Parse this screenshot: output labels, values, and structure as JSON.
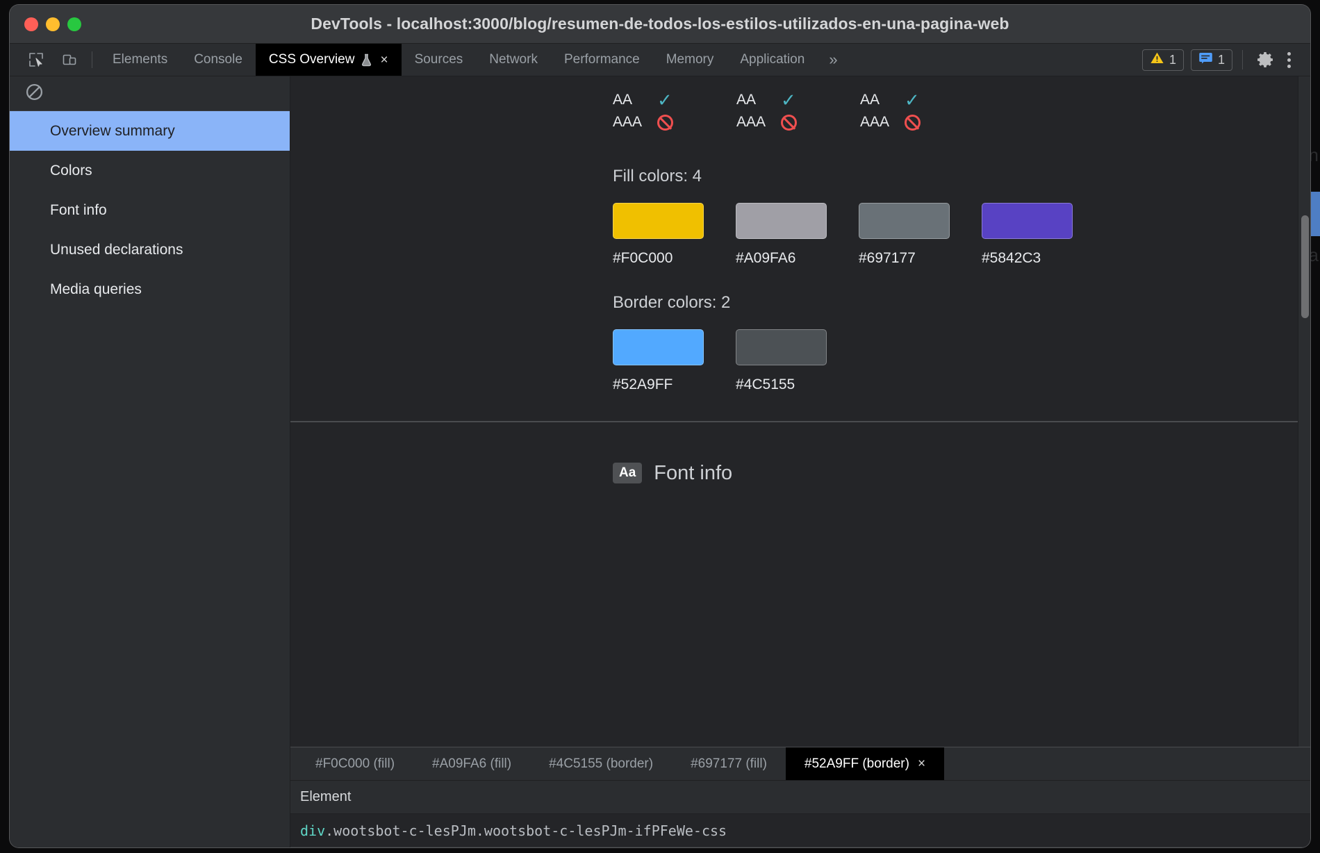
{
  "window": {
    "title": "DevTools - localhost:3000/blog/resumen-de-todos-los-estilos-utilizados-en-una-pagina-web",
    "traffic_lights": [
      "close",
      "minimize",
      "maximize"
    ]
  },
  "tabbar": {
    "inspect_icon": "inspect-cursor-icon",
    "device_icon": "device-toolbar-icon",
    "tabs": [
      {
        "label": "Elements",
        "active": false,
        "experimental": false,
        "closable": false
      },
      {
        "label": "Console",
        "active": false,
        "experimental": false,
        "closable": false
      },
      {
        "label": "CSS Overview",
        "active": true,
        "experimental": true,
        "closable": true
      },
      {
        "label": "Sources",
        "active": false,
        "experimental": false,
        "closable": false
      },
      {
        "label": "Network",
        "active": false,
        "experimental": false,
        "closable": false
      },
      {
        "label": "Performance",
        "active": false,
        "experimental": false,
        "closable": false
      },
      {
        "label": "Memory",
        "active": false,
        "experimental": false,
        "closable": false
      },
      {
        "label": "Application",
        "active": false,
        "experimental": false,
        "closable": false
      }
    ],
    "overflow_label": "»",
    "close_glyph": "×",
    "warning_badge": {
      "icon": "warning-triangle-icon",
      "count": "1",
      "color": "#f5c518"
    },
    "message_badge": {
      "icon": "message-bubble-icon",
      "count": "1",
      "color": "#4f9cf9"
    },
    "settings_icon": "gear-icon",
    "more_icon": "kebab-menu-icon"
  },
  "sidebar": {
    "toolbar_icon": "clear-no-entry-icon",
    "items": [
      {
        "label": "Overview summary",
        "selected": true
      },
      {
        "label": "Colors",
        "selected": false
      },
      {
        "label": "Font info",
        "selected": false
      },
      {
        "label": "Unused declarations",
        "selected": false
      },
      {
        "label": "Media queries",
        "selected": false
      }
    ],
    "selected_bg": "#8ab4f8"
  },
  "main": {
    "contrast_groups": [
      {
        "aa_label": "AA",
        "aa_status": "pass",
        "aaa_label": "AAA",
        "aaa_status": "fail"
      },
      {
        "aa_label": "AA",
        "aa_status": "pass",
        "aaa_label": "AAA",
        "aaa_status": "fail"
      },
      {
        "aa_label": "AA",
        "aa_status": "pass",
        "aaa_label": "AAA",
        "aaa_status": "fail"
      }
    ],
    "pass_glyph": "✓",
    "pass_color": "#4db6c4",
    "fail_color": "#ef4f4f",
    "fill_colors": {
      "title": "Fill colors: 4",
      "swatches": [
        {
          "hex": "#F0C000"
        },
        {
          "hex": "#A09FA6"
        },
        {
          "hex": "#697177"
        },
        {
          "hex": "#5842C3"
        }
      ]
    },
    "border_colors": {
      "title": "Border colors: 2",
      "swatches": [
        {
          "hex": "#52A9FF"
        },
        {
          "hex": "#4C5155"
        }
      ]
    },
    "font_info": {
      "badge": "Aa",
      "title": "Font info"
    }
  },
  "drawer": {
    "color_tabs": [
      {
        "label": "#F0C000 (fill)",
        "active": false
      },
      {
        "label": "#A09FA6 (fill)",
        "active": false
      },
      {
        "label": "#4C5155 (border)",
        "active": false
      },
      {
        "label": "#697177 (fill)",
        "active": false
      },
      {
        "label": "#52A9FF (border)",
        "active": true
      }
    ],
    "close_glyph": "×",
    "column_header": "Element",
    "rows": [
      {
        "tag": "div",
        "classes": ".wootsbot-c-lesPJm.wootsbot-c-lesPJm-ifPFeWe-css"
      }
    ]
  },
  "backdrop": {
    "right_fragments": [
      "n",
      "´a",
      ""
    ],
    "bottom_left": "",
    "bottom_right": ""
  }
}
